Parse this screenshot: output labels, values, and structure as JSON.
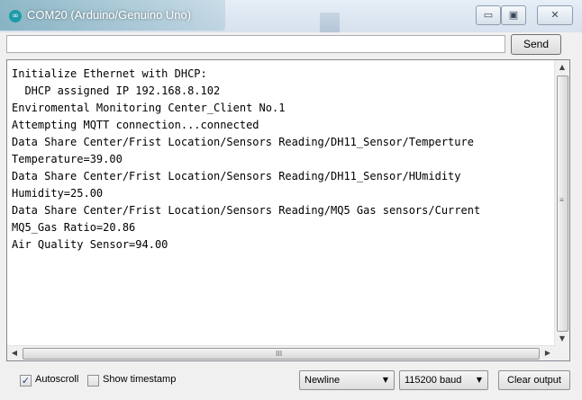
{
  "window": {
    "title": "COM20 (Arduino/Genuino Uno)",
    "app_icon": "arduino-icon",
    "controls": {
      "minimize": "▭",
      "maximize": "▣",
      "close": "✕"
    }
  },
  "input": {
    "value": "",
    "send_label": "Send"
  },
  "output": {
    "lines": [
      "Initialize Ethernet with DHCP:",
      "  DHCP assigned IP 192.168.8.102",
      "Enviromental Monitoring Center_Client No.1",
      "Attempting MQTT connection...connected",
      "Data Share Center/Frist Location/Sensors Reading/DH11_Sensor/Temperture",
      "Temperature=39.00",
      "Data Share Center/Frist Location/Sensors Reading/DH11_Sensor/HUmidity",
      "Humidity=25.00",
      "Data Share Center/Frist Location/Sensors Reading/MQ5 Gas sensors/Current",
      "MQ5_Gas Ratio=20.86",
      "Air Quality Sensor=94.00"
    ]
  },
  "scrollbars": {
    "up": "▲",
    "down": "▼",
    "left": "◀",
    "right": "▶",
    "h_grip": "III"
  },
  "footer": {
    "autoscroll": {
      "label": "Autoscroll",
      "checked": true,
      "mark": "✓"
    },
    "show_timestamp": {
      "label": "Show timestamp",
      "checked": false
    },
    "line_ending": {
      "selected": "Newline",
      "arrow": "▼"
    },
    "baud_rate": {
      "selected": "115200 baud",
      "arrow": "▼"
    },
    "clear_label": "Clear output"
  }
}
